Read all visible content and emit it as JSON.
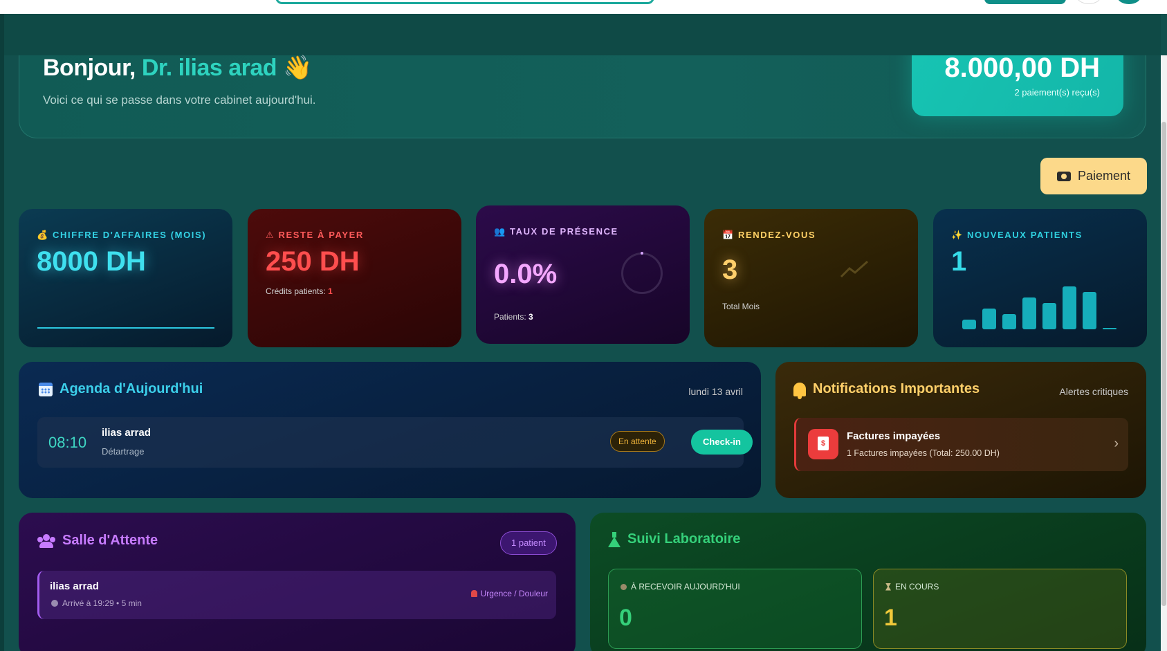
{
  "greeting": {
    "hello": "Bonjour,",
    "doctor": "Dr. ilias arad",
    "wave": "👋",
    "subtitle": "Voici ce qui se passe dans votre cabinet aujourd'hui."
  },
  "revenue_card": {
    "amount": "8.000,00 DH",
    "note": "2 paiement(s) reçu(s)"
  },
  "payment_button": {
    "label": "Paiement",
    "icon": "money-icon"
  },
  "stats": {
    "revenue": {
      "label": "CHIFFRE D'AFFAIRES (MOIS)",
      "value": "8000 DH",
      "color": "#3fe0ef"
    },
    "due": {
      "label": "RESTE À PAYER",
      "value": "250 DH",
      "credits_label": "Crédits patients:",
      "credits_value": "1",
      "color": "#ff4e4e"
    },
    "attendance": {
      "label": "TAUX DE PRÉSENCE",
      "value": "0.0%",
      "patients_label": "Patients:",
      "patients_value": "3",
      "color": "#f4a7ff"
    },
    "appointments": {
      "label": "RENDEZ-VOUS",
      "value": "3",
      "sub": "Total Mois",
      "color": "#ffcf6b"
    },
    "new_patients": {
      "label": "NOUVEAUX PATIENTS",
      "value": "1",
      "color": "#36dbe8"
    }
  },
  "agenda": {
    "title": "Agenda d'Aujourd'hui",
    "date": "lundi 13 avril",
    "items": [
      {
        "time": "08:10",
        "patient": "ilias arrad",
        "type": "Détartrage",
        "status": "En attente",
        "action": "Check-in"
      }
    ]
  },
  "notifications": {
    "title": "Notifications Importantes",
    "subtitle": "Alertes critiques",
    "items": [
      {
        "title": "Factures impayées",
        "desc": "1 Factures impayées (Total: 250.00 DH)"
      }
    ]
  },
  "waiting_room": {
    "title": "Salle d'Attente",
    "badge": "1 patient",
    "items": [
      {
        "name": "ilias arrad",
        "arrival": "Arrivé à 19:29 • 5 min",
        "reason": "Urgence / Douleur"
      }
    ]
  },
  "lab": {
    "title": "Suivi Laboratoire",
    "receive_label": "À RECEVOIR AUJOURD'HUI",
    "receive_value": "0",
    "inprogress_label": "EN COURS",
    "inprogress_value": "1"
  }
}
